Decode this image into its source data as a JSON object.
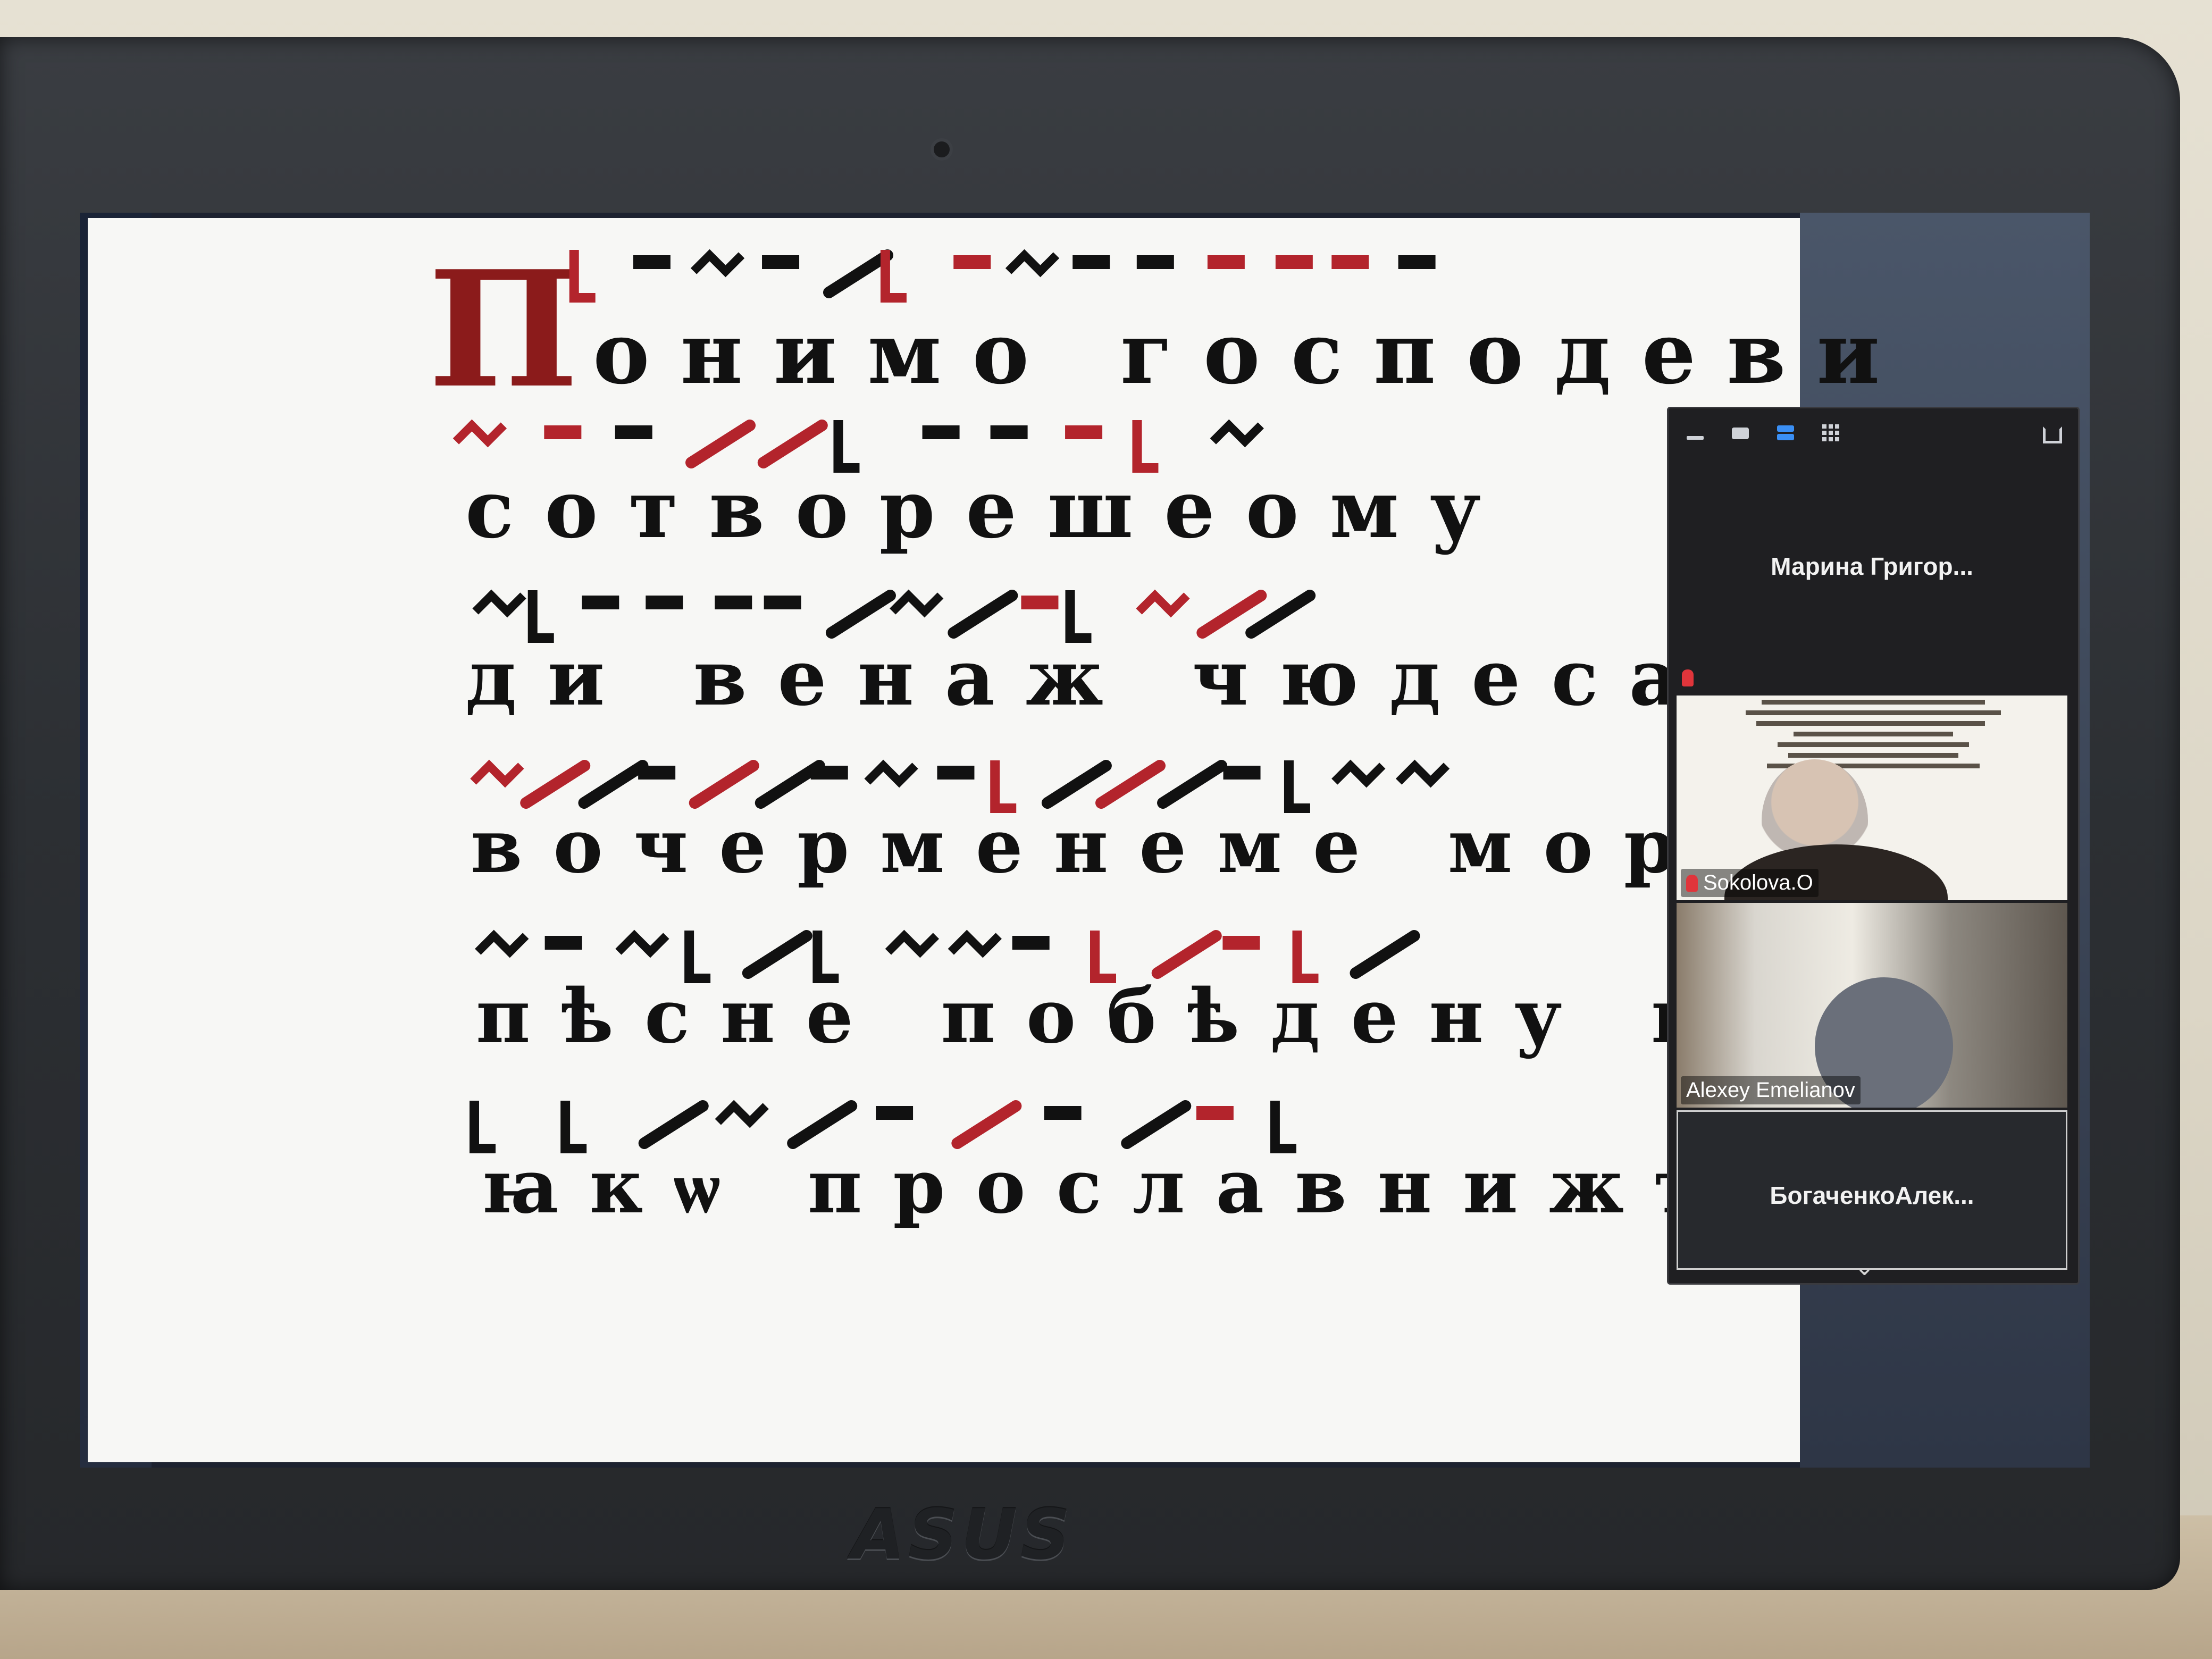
{
  "laptop": {
    "brand": "ASUS"
  },
  "slide": {
    "initial": "П",
    "lines": [
      {
        "text": "онимо господеви"
      },
      {
        "text": "сотворешеому"
      },
      {
        "text": "ди венаж чюдеса"
      },
      {
        "text": "вочерменеме мори"
      },
      {
        "text": "пѣсне побѣдену ю"
      },
      {
        "text": "ꙗкѡ прославнижъ ."
      }
    ]
  },
  "zoom_panel": {
    "toolbar": {
      "minimize": "minimize-icon",
      "single_view": "single-view-icon",
      "strip_view": "strip-view-icon",
      "grid_view": "grid-view-icon",
      "popout": "popout-icon"
    },
    "participants": [
      {
        "name": "Марина Григор..."
      },
      {
        "name": "Sokolova.O"
      },
      {
        "name": "Alexey Emelianov"
      },
      {
        "name": "БогаченкоАлек..."
      }
    ],
    "more_icon": "chevron-down-icon"
  },
  "colors": {
    "neume_black": "#111111",
    "neume_red": "#b3242c",
    "accent_blue": "#3a8ff5"
  }
}
